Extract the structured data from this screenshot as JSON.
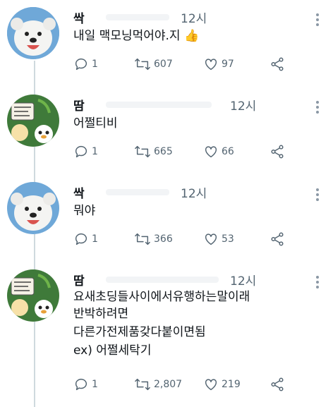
{
  "tweets": [
    {
      "name": "싹",
      "time": "12시",
      "text": "내일 맥모닝먹어야.지 👍",
      "replies": "1",
      "retweets": "607",
      "likes": "97",
      "avatar_icon": "white-puppy-avatar"
    },
    {
      "name": "땀",
      "time": "12시",
      "text": "어쩔티비",
      "replies": "1",
      "retweets": "665",
      "likes": "66",
      "avatar_icon": "green-cartoon-avatar"
    },
    {
      "name": "싹",
      "time": "12시",
      "text": "뭐야",
      "replies": "1",
      "retweets": "366",
      "likes": "53",
      "avatar_icon": "white-puppy-avatar"
    },
    {
      "name": "땀",
      "time": "12시",
      "lines": [
        "요새초딩들사이에서유행하는말이래",
        "반박하려면",
        "다른가전제품갖다붙이면됨",
        "ex) 어쩔세탁기"
      ],
      "replies": "1",
      "retweets": "2,807",
      "likes": "219",
      "avatar_icon": "green-cartoon-avatar"
    }
  ],
  "colors": {
    "icon_gray": "#536471",
    "thread_line": "#cfd9de",
    "puppy_bg": "#6fa8d8",
    "cartoon_bg": "#3f7a3a"
  }
}
